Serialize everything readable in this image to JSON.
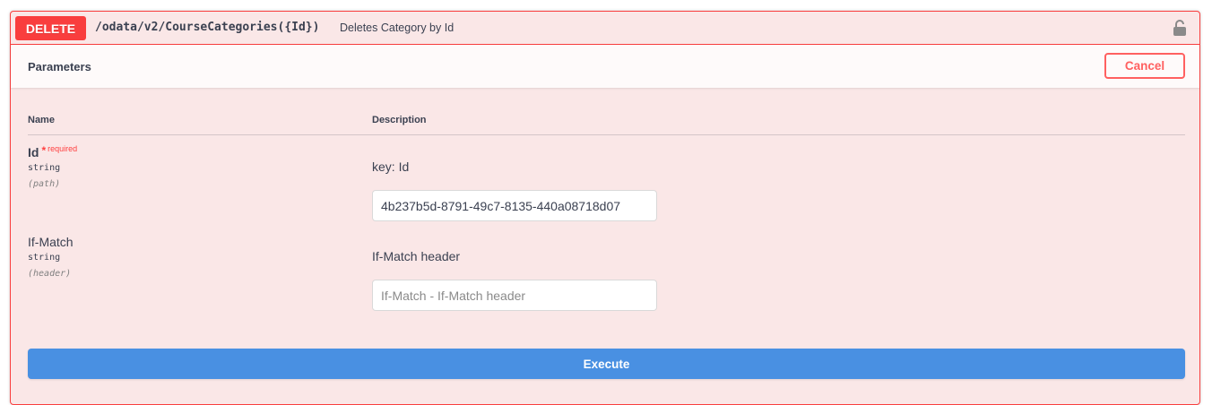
{
  "operation": {
    "method": "DELETE",
    "path": "/odata/v2/CourseCategories({Id})",
    "summary": "Deletes Category by Id",
    "lock_icon": "lock-icon",
    "method_color": "#f93e3e"
  },
  "parameters_section": {
    "title": "Parameters",
    "cancel_label": "Cancel",
    "columns": {
      "name": "Name",
      "description": "Description"
    }
  },
  "params": [
    {
      "name": "Id",
      "required_star": "*",
      "required_label": "required",
      "type": "string",
      "location": "(path)",
      "description": "key: Id",
      "value": "4b237b5d-8791-49c7-8135-440a08718d07",
      "placeholder": ""
    },
    {
      "name": "If-Match",
      "type": "string",
      "location": "(header)",
      "description": "If-Match header",
      "value": "",
      "placeholder": "If-Match - If-Match header"
    }
  ],
  "execute_label": "Execute",
  "execute_color": "#4990e2"
}
